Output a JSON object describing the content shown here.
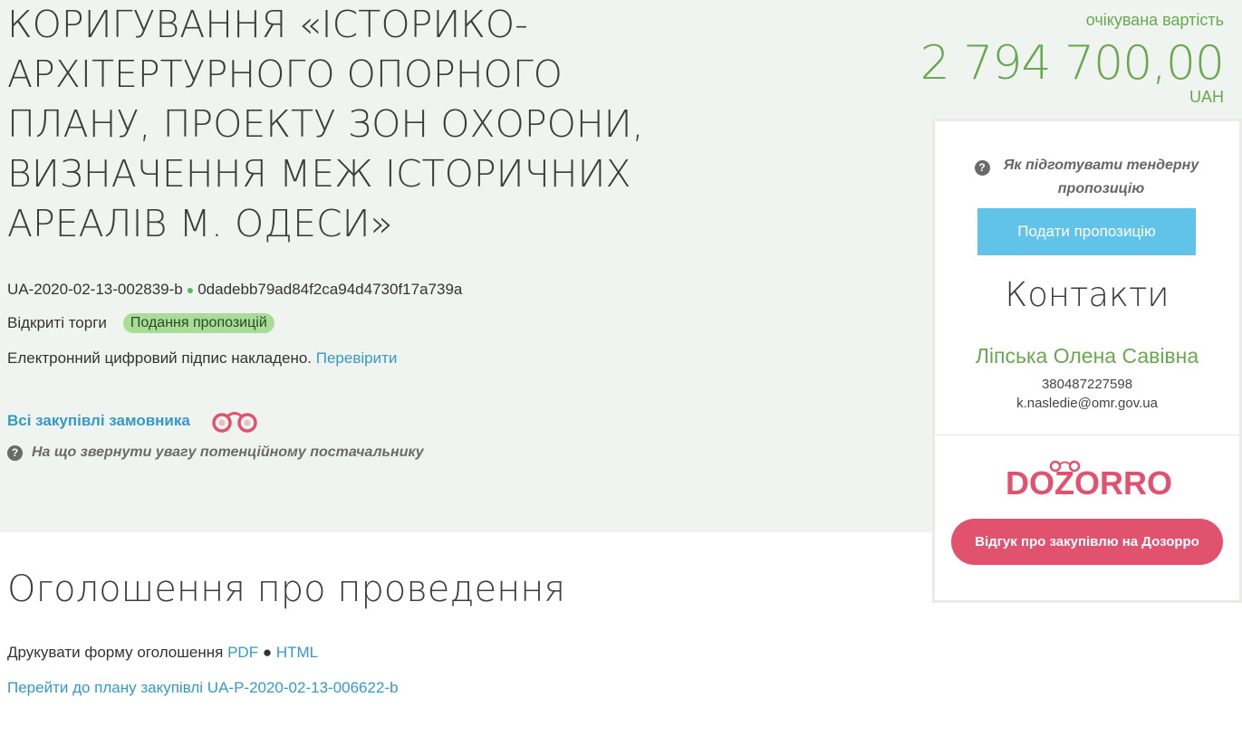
{
  "tender": {
    "title": "КОРИГУВАННЯ «ІСТОРИКО-АРХІТЕРТУРНОГО ОПОРНОГО ПЛАНУ, ПРОЕКТУ ЗОН ОХОРОНИ, ВИЗНАЧЕННЯ МЕЖ ІСТОРИЧНИХ АРЕАЛІВ М. ОДЕСИ»",
    "id": "UA-2020-02-13-002839-b",
    "hash": "0dadebb79ad84f2ca94d4730f17a739a",
    "procedure": "Відкриті торги",
    "status": "Подання пропозицій",
    "signature_text": "Електронний цифровий підпис накладено.",
    "signature_link": "Перевірити",
    "all_purchases": "Всі закупівлі замовника",
    "supplier_hint": "На що звернути увагу потенційному постачальнику"
  },
  "price": {
    "label": "очікувана вартість",
    "amount": "2 794 700,00",
    "currency": "UAH"
  },
  "sidebar": {
    "hint": "Як підготувати тендерну пропозицію",
    "submit_label": "Подати пропозицію",
    "contacts_heading": "Контакти",
    "contact_name": "Ліпська Олена Савівна",
    "contact_phone": "380487227598",
    "contact_email": "k.nasledie@omr.gov.ua",
    "dozorro_button": "Відгук про закупівлю на Дозорро"
  },
  "announcement": {
    "heading": "Оголошення про проведення",
    "print_text": "Друкувати форму оголошення",
    "pdf": "PDF",
    "html": "HTML",
    "plan_link": "Перейти до плану закупівлі UA-P-2020-02-13-006622-b"
  },
  "colors": {
    "hero_bg": "#f0f4f1",
    "green": "#6aa84f",
    "link": "#3499c9",
    "submit_btn": "#62c3e9",
    "dozorro": "#e0526d",
    "badge": "#a9dc97"
  }
}
